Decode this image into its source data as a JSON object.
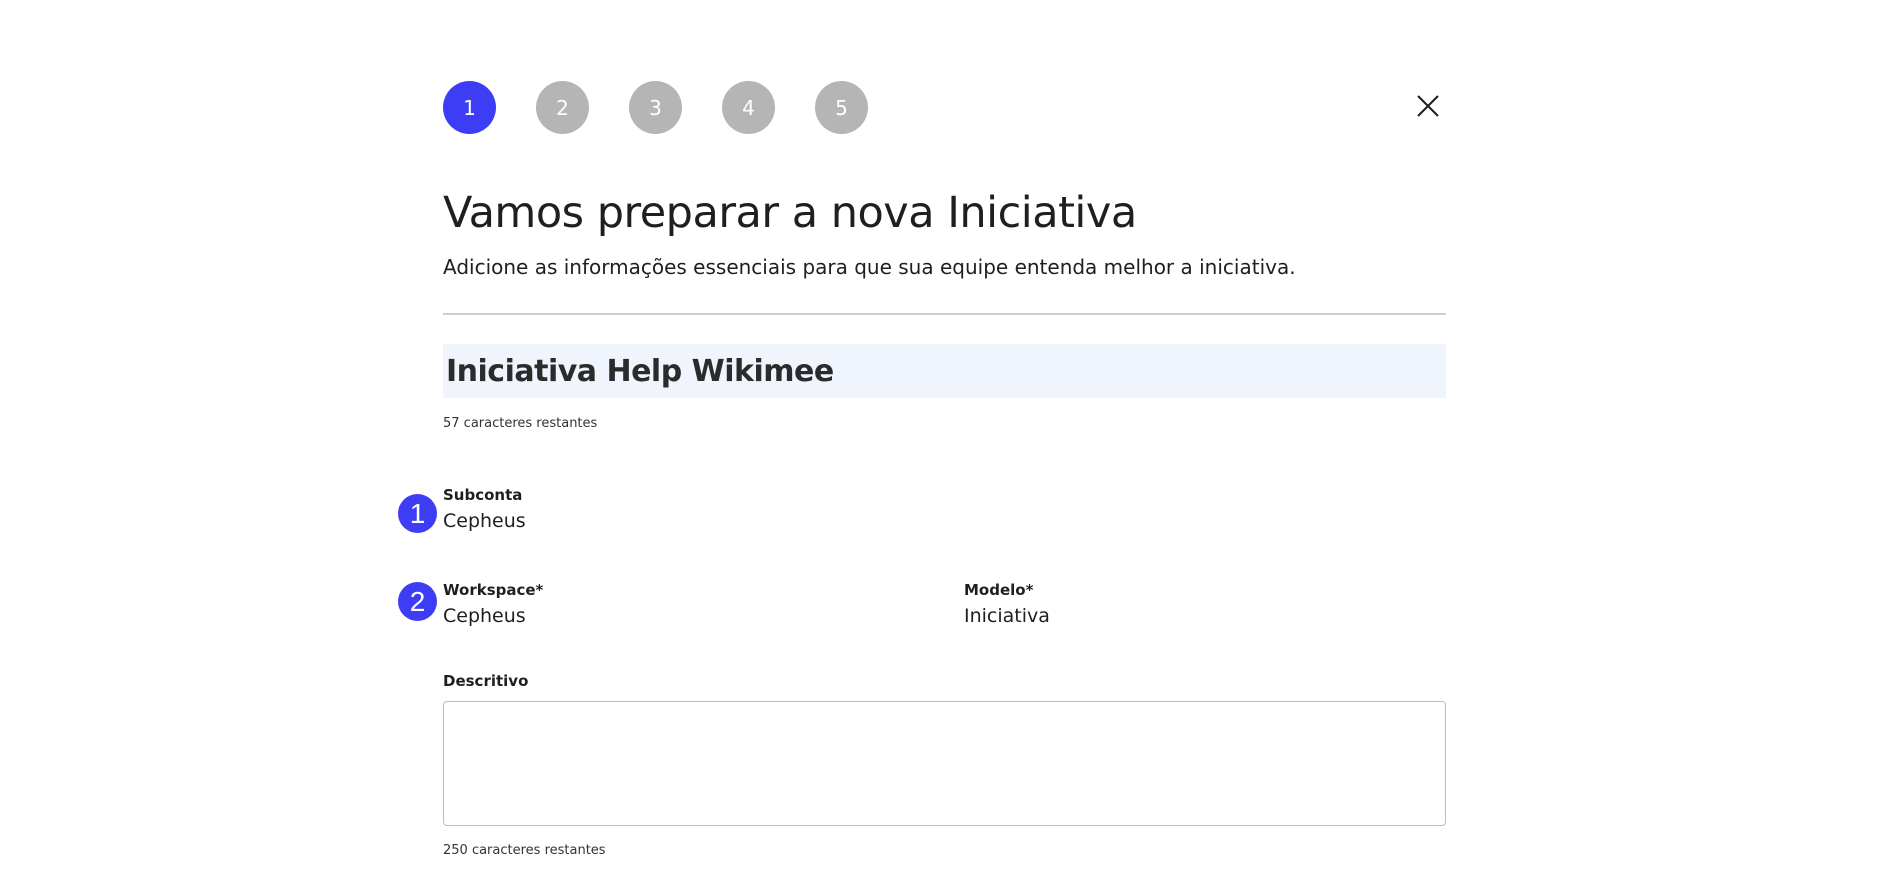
{
  "stepper": {
    "steps": [
      {
        "label": "1",
        "active": true
      },
      {
        "label": "2",
        "active": false
      },
      {
        "label": "3",
        "active": false
      },
      {
        "label": "4",
        "active": false
      },
      {
        "label": "5",
        "active": false
      }
    ]
  },
  "close_icon": "close-icon",
  "header": {
    "title": "Vamos preparar a nova Iniciativa",
    "subtitle": "Adicione as informações essenciais para que sua equipe entenda melhor a iniciativa."
  },
  "name_field": {
    "value": "Iniciativa Help Wikimee",
    "counter": "57 caracteres restantes"
  },
  "markers": {
    "first": "1",
    "second": "2"
  },
  "subconta": {
    "label": "Subconta",
    "value": "Cepheus"
  },
  "workspace": {
    "label": "Workspace*",
    "value": "Cepheus"
  },
  "modelo": {
    "label": "Modelo*",
    "value": "Iniciativa"
  },
  "descritivo": {
    "label": "Descritivo",
    "value": "",
    "counter": "250 caracteres restantes"
  },
  "colors": {
    "accent": "#3d3df5",
    "step_inactive": "#b5b5b5",
    "input_background": "#f0f4fd"
  }
}
